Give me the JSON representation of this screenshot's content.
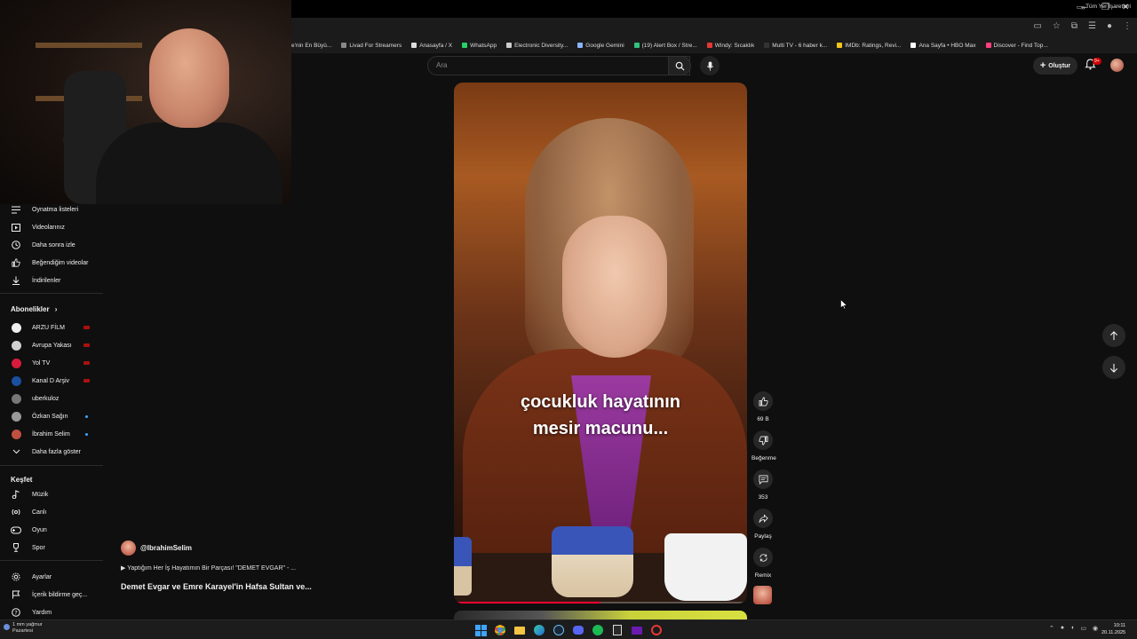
{
  "window": {
    "minimize": "–",
    "maximize": "❐",
    "close": "✕"
  },
  "bookmarks": [
    {
      "label": "e'nin En Büyü...",
      "color": "#e53935"
    },
    {
      "label": "Livad For Streamers",
      "color": "#888888"
    },
    {
      "label": "Anasayfa / X",
      "color": "#dddddd"
    },
    {
      "label": "WhatsApp",
      "color": "#25d366"
    },
    {
      "label": "Electronic Diversity...",
      "color": "#cccccc"
    },
    {
      "label": "Google Gemini",
      "color": "#8ab4f8"
    },
    {
      "label": "(19) Alert Box / Stre...",
      "color": "#31c27c"
    },
    {
      "label": "Windy: Sıcaklık",
      "color": "#e53935"
    },
    {
      "label": "Multi TV - 6 haber k...",
      "color": "#333333"
    },
    {
      "label": "IMDb: Ratings, Revi...",
      "color": "#f5c518"
    },
    {
      "label": "Ana Sayfa • HBO Max",
      "color": "#ffffff"
    },
    {
      "label": "Discover - Find Top...",
      "color": "#ff4081"
    }
  ],
  "bookmarks_more": "»",
  "bookmarks_all": "Tüm Yer İşaretleri",
  "search": {
    "placeholder": "Ara"
  },
  "header": {
    "create_label": "Oluştur",
    "notification_count": "9+"
  },
  "sidebar": {
    "you_items": [
      {
        "label": "Oynatma listeleri",
        "icon": "playlist-icon"
      },
      {
        "label": "Videolarınız",
        "icon": "your-videos-icon"
      },
      {
        "label": "Daha sonra izle",
        "icon": "watch-later-icon"
      },
      {
        "label": "Beğendiğim videolar",
        "icon": "liked-icon"
      },
      {
        "label": "İndirilenler",
        "icon": "download-icon"
      }
    ],
    "subscriptions_title": "Abonelikler",
    "subscriptions": [
      {
        "label": "ARZU FİLM",
        "avatar_color": "#eeeeee",
        "status": "live"
      },
      {
        "label": "Avrupa Yakası",
        "avatar_color": "#d0d0d0",
        "status": "live"
      },
      {
        "label": "Yol TV",
        "avatar_color": "#d81b3c",
        "status": "live"
      },
      {
        "label": "Kanal D Arşiv",
        "avatar_color": "#1b4fa0",
        "status": "live"
      },
      {
        "label": "uberkuloz",
        "avatar_color": "#777777",
        "status": "none"
      },
      {
        "label": "Özkan Sağın",
        "avatar_color": "#999999",
        "status": "new"
      },
      {
        "label": "İbrahim Selim",
        "avatar_color": "#c05040",
        "status": "new"
      }
    ],
    "show_more": "Daha fazla göster",
    "explore_title": "Keşfet",
    "explore_items": [
      {
        "label": "Müzik",
        "icon": "music-icon"
      },
      {
        "label": "Canlı",
        "icon": "live-icon"
      },
      {
        "label": "Oyun",
        "icon": "gaming-icon"
      },
      {
        "label": "Spor",
        "icon": "trophy-icon"
      }
    ],
    "footer_items": [
      {
        "label": "Ayarlar",
        "icon": "gear-icon"
      },
      {
        "label": "İçerik bildirme geç...",
        "icon": "flag-icon"
      },
      {
        "label": "Yardım",
        "icon": "help-icon"
      }
    ]
  },
  "short": {
    "caption_line1": "çocukluk hayatının",
    "caption_line2": "mesir macunu...",
    "progress": 0.5,
    "channel": "@IbrahimSelim",
    "promo": "▶ Yaptığım Her İş Hayatımın Bir Parçası! \"DEMET EVGAR\" - ...",
    "title": "Demet Evgar ve Emre Karayel'in Hafsa Sultan ve..."
  },
  "actions": {
    "like_count": "69 B",
    "dislike_label": "Beğenme",
    "comment_count": "353",
    "share_label": "Paylaş",
    "remix_label": "Remix"
  },
  "taskbar": {
    "weather_line1": "1 mm yağmur",
    "weather_line2": "Pazartesi",
    "time": "10:11",
    "date": "20.11.2025"
  }
}
